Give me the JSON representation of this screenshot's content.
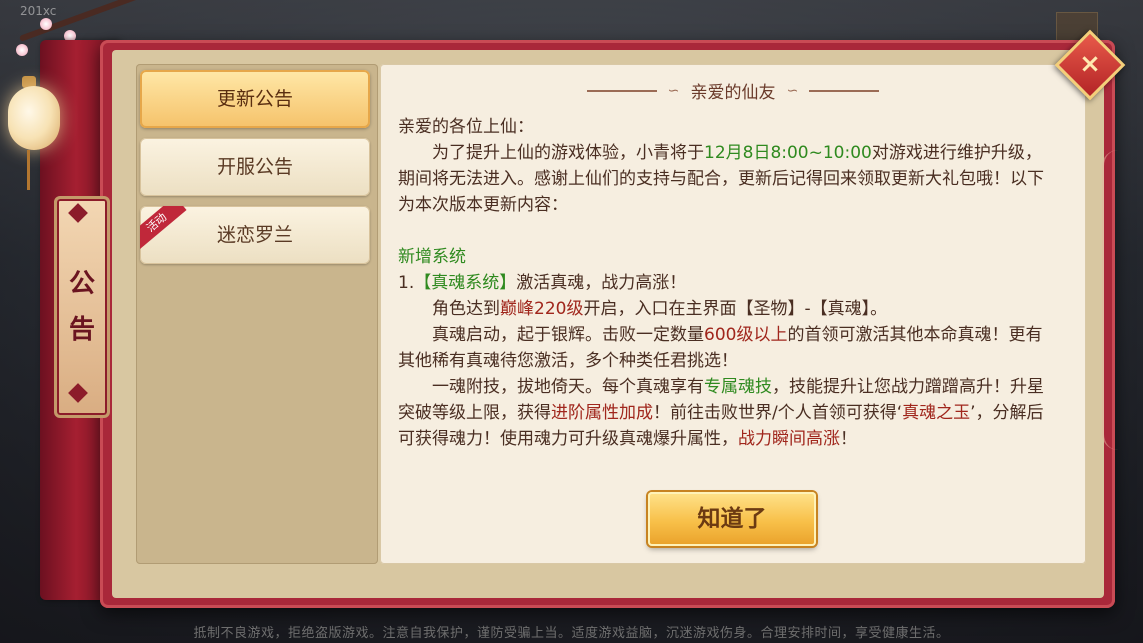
{
  "hud": {
    "top_left": "201xc"
  },
  "side_tag": {
    "label_line1": "公",
    "label_line2": "告"
  },
  "tabs": [
    {
      "label": "更新公告",
      "active": true,
      "badge": ""
    },
    {
      "label": "开服公告",
      "active": false,
      "badge": ""
    },
    {
      "label": "迷恋罗兰",
      "active": false,
      "badge": "活动"
    }
  ],
  "notice": {
    "title": "亲爱的仙友",
    "greeting": "亲爱的各位上仙：",
    "intro_a": "为了提升上仙的游戏体验，小青将于",
    "intro_time": "12月8日8:00~10:00",
    "intro_b": "对游戏进行维护升级，期间将无法进入。感谢上仙们的支持与配合，更新后记得回来领取更新大礼包哦！以下为本次版本更新内容：",
    "section_heading": "新增系统",
    "item1_prefix": "1.",
    "item1_tag": "【真魂系统】",
    "item1_text": "激活真魂，战力高涨！",
    "p1_a": "角色达到",
    "p1_hl": "巅峰220级",
    "p1_b": "开启，入口在主界面【圣物】-【真魂】。",
    "p2_a": "真魂启动，起于银辉。击败一定数量",
    "p2_hl": "600级以上",
    "p2_b": "的首领可激活其他本命真魂！更有其他稀有真魂待您激活，多个种类任君挑选！",
    "p3_a": "一魂附技，拔地倚天。每个真魂享有",
    "p3_hl1": "专属魂技",
    "p3_b": "，技能提升让您战力蹭蹭高升！升星突破等级上限，获得",
    "p3_hl2": "进阶属性加成",
    "p3_c": "！前往击败世界/个人首领可获得‘",
    "p3_hl3": "真魂之玉",
    "p3_d": "’，分解后可获得魂力！使用魂力可升级真魂爆升属性，",
    "p3_hl4": "战力瞬间高涨",
    "p3_e": "！"
  },
  "confirm_button": "知道了",
  "close_button": "×",
  "footer": "抵制不良游戏，拒绝盗版游戏。注意自我保护，谨防受骗上当。适度游戏益脑，沉迷游戏伤身。合理安排时间，享受健康生活。",
  "colors": {
    "highlight_green": "#2f8a1f",
    "highlight_red": "#a0261c",
    "frame_red": "#a9283a",
    "button_gold": "#f8c049"
  },
  "icons": {
    "close": "close-icon",
    "lantern": "lantern-icon",
    "blossom": "plum-blossom-icon"
  }
}
